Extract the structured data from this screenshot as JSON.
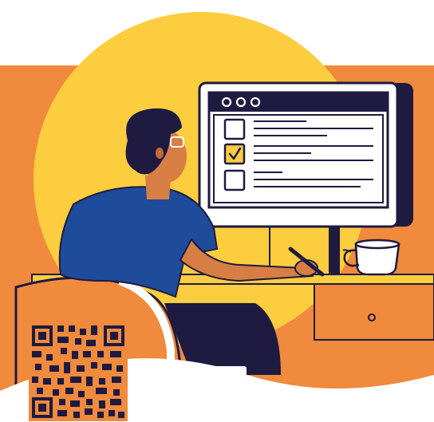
{
  "scene": {
    "monitor": {
      "window_controls": [
        "dot",
        "dot",
        "dot"
      ],
      "checklist": [
        {
          "checked": false
        },
        {
          "checked": true
        },
        {
          "checked": false
        }
      ]
    },
    "qr_code": {
      "present": true
    }
  },
  "colors": {
    "orange": "#F08A3C",
    "yellow": "#FCCD3E",
    "navy": "#1E1A40",
    "shirt_blue": "#1E4C9B",
    "skin": "#D77E45",
    "white": "#FFFFFF"
  }
}
